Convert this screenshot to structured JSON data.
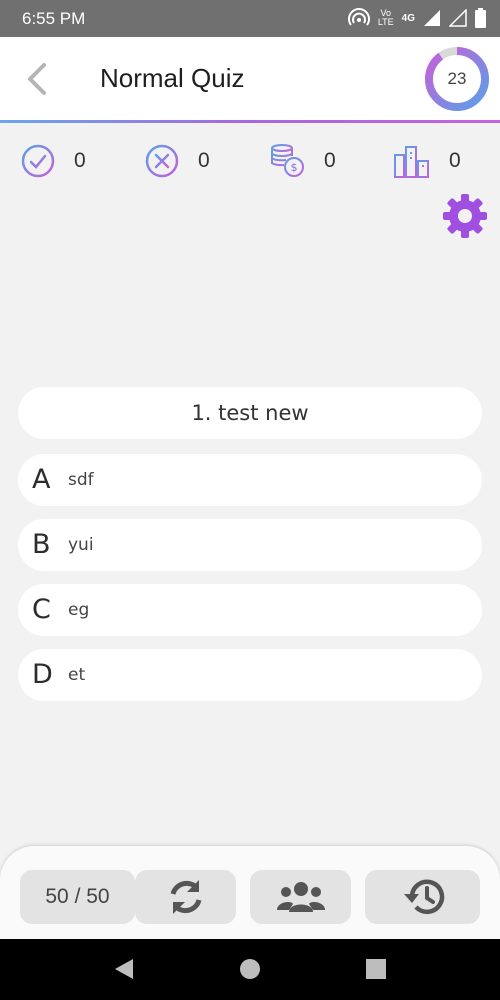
{
  "status_bar": {
    "time": "6:55 PM",
    "volte_label_top": "Vo",
    "volte_label_bottom": "LTE",
    "network_label": "4G"
  },
  "header": {
    "title": "Normal Quiz",
    "timer_value": "23",
    "timer_progress": 0.9
  },
  "stats": {
    "correct": "0",
    "wrong": "0",
    "coins": "0",
    "score": "0"
  },
  "question": {
    "text": "1. test new",
    "options": [
      {
        "letter": "A",
        "text": "sdf"
      },
      {
        "letter": "B",
        "text": "yui"
      },
      {
        "letter": "C",
        "text": "eg"
      },
      {
        "letter": "D",
        "text": "et"
      }
    ]
  },
  "toolbar": {
    "fifty_fifty_label": "50 / 50"
  },
  "colors": {
    "accent_purple": "#a14fe0",
    "accent_blue": "#5aa0e8",
    "accent_magenta": "#c75fd8",
    "statusbar_bg": "#707070"
  }
}
